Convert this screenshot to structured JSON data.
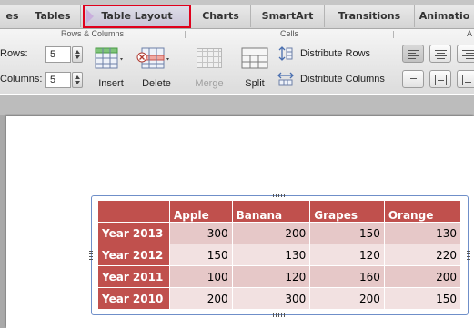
{
  "tabs": [
    {
      "label": "es",
      "active": false
    },
    {
      "label": "Tables",
      "active": false
    },
    {
      "label": "Table Layout",
      "active": true
    },
    {
      "label": "Charts",
      "active": false
    },
    {
      "label": "SmartArt",
      "active": false
    },
    {
      "label": "Transitions",
      "active": false
    },
    {
      "label": "Animatio",
      "active": false
    }
  ],
  "ribbon": {
    "groups": {
      "rows_columns": "Rows & Columns",
      "cells": "Cells",
      "alignment_partial": "A"
    },
    "rows_label": "Rows:",
    "rows_value": "5",
    "columns_label": "Columns:",
    "columns_value": "5",
    "insert_label": "Insert",
    "delete_label": "Delete",
    "merge_label": "Merge",
    "split_label": "Split",
    "distribute_rows_label": "Distribute Rows",
    "distribute_columns_label": "Distribute Columns"
  },
  "table": {
    "headers": [
      "",
      "Apple",
      "Banana",
      "Grapes",
      "Orange"
    ],
    "rows": [
      {
        "label": "Year 2013",
        "values": [
          "300",
          "200",
          "150",
          "130"
        ]
      },
      {
        "label": "Year 2012",
        "values": [
          "150",
          "130",
          "120",
          "220"
        ]
      },
      {
        "label": "Year 2011",
        "values": [
          "100",
          "120",
          "160",
          "200"
        ]
      },
      {
        "label": "Year 2010",
        "values": [
          "200",
          "300",
          "200",
          "150"
        ]
      }
    ]
  },
  "colors": {
    "header_fill": "#c0504d",
    "band_dark": "#e6c8c8",
    "band_light": "#f2e1e1",
    "active_tab_border": "#e0001c"
  },
  "icons": [
    "insert-table-icon",
    "delete-table-icon",
    "merge-cells-icon",
    "split-cells-icon",
    "distribute-rows-icon",
    "distribute-columns-icon",
    "align-left-icon",
    "align-center-icon",
    "align-right-icon"
  ]
}
